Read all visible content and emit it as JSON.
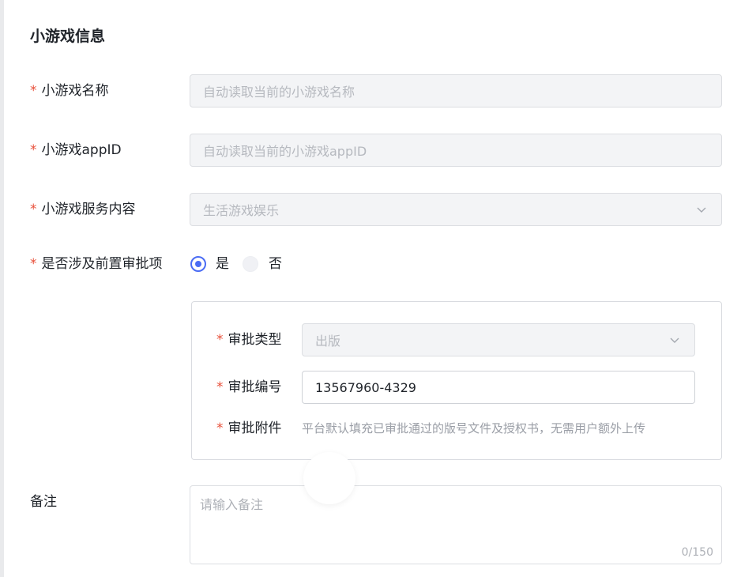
{
  "section_title": "小游戏信息",
  "required_mark": "*",
  "fields": {
    "name": {
      "label": "小游戏名称",
      "placeholder": "自动读取当前的小游戏名称"
    },
    "appid": {
      "label": "小游戏appID",
      "placeholder": "自动读取当前的小游戏appID"
    },
    "service": {
      "label": "小游戏服务内容",
      "value": "生活游戏娱乐"
    },
    "pre_approval": {
      "label": "是否涉及前置审批项",
      "options": [
        "是",
        "否"
      ],
      "selected": "是"
    }
  },
  "approval": {
    "type_label": "审批类型",
    "type_value": "出版",
    "number_label": "审批编号",
    "number_value": "13567960-4329",
    "attachment_label": "审批附件",
    "attachment_hint": "平台默认填充已审批通过的版号文件及授权书，无需用户额外上传"
  },
  "remark": {
    "label": "备注",
    "placeholder": "请输入备注",
    "counter": "0/150"
  },
  "colors": {
    "accent": "#4a6cf4",
    "required": "#e8503a"
  },
  "icons": {
    "select_arrow": "chevron-down-icon"
  }
}
